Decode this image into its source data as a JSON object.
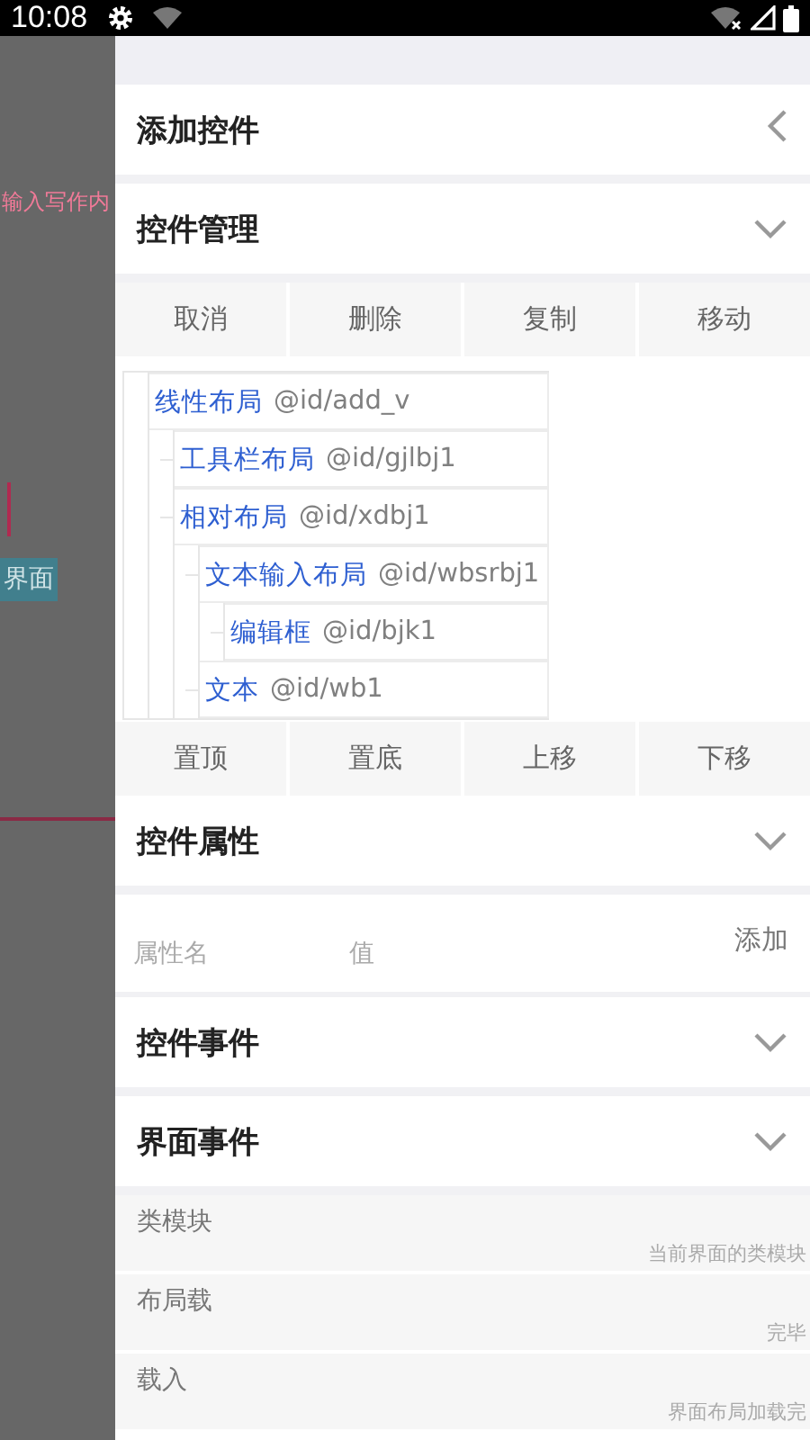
{
  "status_bar": {
    "time": "10:08"
  },
  "backdrop": {
    "text": "输入写作内",
    "tag": "界面"
  },
  "drawer": [
    {
      "kind": "header",
      "title": "添加控件",
      "expanded": false
    },
    {
      "kind": "header",
      "title": "控件管理",
      "expanded": true
    },
    {
      "kind": "buttons",
      "labels": [
        "取消",
        "删除",
        "复制",
        "移动"
      ]
    },
    {
      "kind": "tree",
      "nodes": [
        {
          "name": "线性布局",
          "ref": "@id/add_v",
          "children": [
            {
              "name": "工具栏布局",
              "ref": "@id/gjlbj1"
            },
            {
              "name": "相对布局",
              "ref": "@id/xdbj1",
              "children": [
                {
                  "name": "文本输入布局",
                  "ref": "@id/wbsrbj1",
                  "children": [
                    {
                      "name": "编辑框",
                      "ref": "@id/bjk1"
                    }
                  ]
                },
                {
                  "name": "文本",
                  "ref": "@id/wb1"
                }
              ]
            }
          ]
        }
      ]
    },
    {
      "kind": "buttons",
      "labels": [
        "置顶",
        "置底",
        "上移",
        "下移"
      ]
    },
    {
      "kind": "header",
      "title": "控件属性",
      "expanded": true
    },
    {
      "kind": "property",
      "name_placeholder": "属性名",
      "value_placeholder": "值",
      "action": "添加"
    },
    {
      "kind": "header",
      "title": "控件事件",
      "expanded": true
    },
    {
      "kind": "header",
      "title": "界面事件",
      "expanded": true
    },
    {
      "kind": "event",
      "name": "类模块",
      "hint": "当前界面的类模块"
    },
    {
      "kind": "event",
      "name": "布局载",
      "hint": "完毕"
    },
    {
      "kind": "event",
      "name": "载入",
      "hint": "界面布局加载完"
    }
  ]
}
